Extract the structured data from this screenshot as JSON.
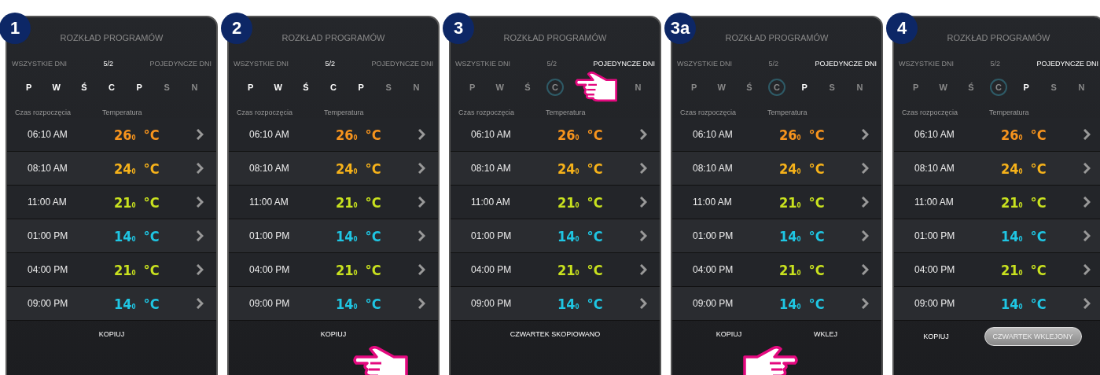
{
  "panels": [
    {
      "step": "1",
      "title": "ROZKŁAD PROGRAMÓW",
      "modes": [
        {
          "label": "WSZYSTKIE DNI",
          "selected": false
        },
        {
          "label": "5/2",
          "selected": true
        },
        {
          "label": "POJEDYNCZE DNI",
          "selected": false
        }
      ],
      "days": [
        {
          "label": "P",
          "selected": true,
          "marked": false
        },
        {
          "label": "W",
          "selected": true,
          "marked": false
        },
        {
          "label": "Ś",
          "selected": true,
          "marked": false
        },
        {
          "label": "C",
          "selected": true,
          "marked": false
        },
        {
          "label": "P",
          "selected": true,
          "marked": false
        },
        {
          "label": "S",
          "selected": false,
          "marked": false
        },
        {
          "label": "N",
          "selected": false,
          "marked": false
        }
      ],
      "headers": [
        "Czas rozpoczęcia",
        "Temperatura"
      ],
      "rows": [
        {
          "time": "06:10 AM",
          "value": "26",
          "decimal": "0",
          "unit": "°C",
          "color": "#f7941d"
        },
        {
          "time": "08:10 AM",
          "value": "24",
          "decimal": "0",
          "unit": "°C",
          "color": "#f6b21a"
        },
        {
          "time": "11:00 AM",
          "value": "21",
          "decimal": "0",
          "unit": "°C",
          "color": "#c9e21f"
        },
        {
          "time": "01:00 PM",
          "value": "14",
          "decimal": "0",
          "unit": "°C",
          "color": "#1fc6e3"
        },
        {
          "time": "04:00 PM",
          "value": "21",
          "decimal": "0",
          "unit": "°C",
          "color": "#c9e21f"
        },
        {
          "time": "09:00 PM",
          "value": "14",
          "decimal": "0",
          "unit": "°C",
          "color": "#1fc6e3"
        }
      ],
      "actions": [
        {
          "kind": "button",
          "label": "KOPIUJ"
        }
      ]
    },
    {
      "step": "2",
      "title": "ROZKŁAD PROGRAMÓW",
      "modes": [
        {
          "label": "WSZYSTKIE DNI",
          "selected": false
        },
        {
          "label": "5/2",
          "selected": true
        },
        {
          "label": "POJEDYNCZE DNI",
          "selected": false
        }
      ],
      "days": [
        {
          "label": "P",
          "selected": true,
          "marked": false
        },
        {
          "label": "W",
          "selected": true,
          "marked": false
        },
        {
          "label": "Ś",
          "selected": true,
          "marked": false
        },
        {
          "label": "C",
          "selected": true,
          "marked": false
        },
        {
          "label": "P",
          "selected": true,
          "marked": false
        },
        {
          "label": "S",
          "selected": false,
          "marked": false
        },
        {
          "label": "N",
          "selected": false,
          "marked": false
        }
      ],
      "headers": [
        "Czas rozpoczęcia",
        "Temperatura"
      ],
      "rows": [
        {
          "time": "06:10 AM",
          "value": "26",
          "decimal": "0",
          "unit": "°C",
          "color": "#f7941d"
        },
        {
          "time": "08:10 AM",
          "value": "24",
          "decimal": "0",
          "unit": "°C",
          "color": "#f6b21a"
        },
        {
          "time": "11:00 AM",
          "value": "21",
          "decimal": "0",
          "unit": "°C",
          "color": "#c9e21f"
        },
        {
          "time": "01:00 PM",
          "value": "14",
          "decimal": "0",
          "unit": "°C",
          "color": "#1fc6e3"
        },
        {
          "time": "04:00 PM",
          "value": "21",
          "decimal": "0",
          "unit": "°C",
          "color": "#c9e21f"
        },
        {
          "time": "09:00 PM",
          "value": "14",
          "decimal": "0",
          "unit": "°C",
          "color": "#1fc6e3"
        }
      ],
      "actions": [
        {
          "kind": "button",
          "label": "KOPIUJ"
        }
      ],
      "hand": {
        "kind": "bottom-left"
      }
    },
    {
      "step": "3",
      "title": "ROZKŁAD PROGRAMÓW",
      "modes": [
        {
          "label": "WSZYSTKIE DNI",
          "selected": false
        },
        {
          "label": "5/2",
          "selected": false
        },
        {
          "label": "POJEDYNCZE DNI",
          "selected": true
        }
      ],
      "days": [
        {
          "label": "P",
          "selected": false,
          "marked": false
        },
        {
          "label": "W",
          "selected": false,
          "marked": false
        },
        {
          "label": "Ś",
          "selected": false,
          "marked": false
        },
        {
          "label": "C",
          "selected": false,
          "marked": true
        },
        {
          "label": "N",
          "selected": false,
          "marked": false
        }
      ],
      "headers": [
        "Czas rozpoczęcia",
        "Temperatura"
      ],
      "rows": [
        {
          "time": "06:10 AM",
          "value": "26",
          "decimal": "0",
          "unit": "°C",
          "color": "#f7941d"
        },
        {
          "time": "08:10 AM",
          "value": "24",
          "decimal": "0",
          "unit": "°C",
          "color": "#f6b21a"
        },
        {
          "time": "11:00 AM",
          "value": "21",
          "decimal": "0",
          "unit": "°C",
          "color": "#c9e21f"
        },
        {
          "time": "01:00 PM",
          "value": "14",
          "decimal": "0",
          "unit": "°C",
          "color": "#1fc6e3"
        },
        {
          "time": "04:00 PM",
          "value": "21",
          "decimal": "0",
          "unit": "°C",
          "color": "#c9e21f"
        },
        {
          "time": "09:00 PM",
          "value": "14",
          "decimal": "0",
          "unit": "°C",
          "color": "#1fc6e3"
        }
      ],
      "actions": [
        {
          "kind": "message",
          "label": "CZWARTEK SKOPIOWANO"
        }
      ],
      "hand": {
        "kind": "days-left"
      }
    },
    {
      "step": "3a",
      "title": "ROZKŁAD PROGRAMÓW",
      "modes": [
        {
          "label": "WSZYSTKIE DNI",
          "selected": false
        },
        {
          "label": "5/2",
          "selected": false
        },
        {
          "label": "POJEDYNCZE DNI",
          "selected": true
        }
      ],
      "days": [
        {
          "label": "P",
          "selected": false,
          "marked": false
        },
        {
          "label": "W",
          "selected": false,
          "marked": false
        },
        {
          "label": "Ś",
          "selected": false,
          "marked": false
        },
        {
          "label": "C",
          "selected": false,
          "marked": true
        },
        {
          "label": "P",
          "selected": true,
          "marked": false
        },
        {
          "label": "S",
          "selected": false,
          "marked": false
        },
        {
          "label": "N",
          "selected": false,
          "marked": false
        }
      ],
      "headers": [
        "Czas rozpoczęcia",
        "Temperatura"
      ],
      "rows": [
        {
          "time": "06:10 AM",
          "value": "26",
          "decimal": "0",
          "unit": "°C",
          "color": "#f7941d"
        },
        {
          "time": "08:10 AM",
          "value": "24",
          "decimal": "0",
          "unit": "°C",
          "color": "#f6b21a"
        },
        {
          "time": "11:00 AM",
          "value": "21",
          "decimal": "0",
          "unit": "°C",
          "color": "#c9e21f"
        },
        {
          "time": "01:00 PM",
          "value": "14",
          "decimal": "0",
          "unit": "°C",
          "color": "#1fc6e3"
        },
        {
          "time": "04:00 PM",
          "value": "21",
          "decimal": "0",
          "unit": "°C",
          "color": "#c9e21f"
        },
        {
          "time": "09:00 PM",
          "value": "14",
          "decimal": "0",
          "unit": "°C",
          "color": "#1fc6e3"
        }
      ],
      "actions": [
        {
          "kind": "button",
          "label": "KOPIUJ"
        },
        {
          "kind": "button",
          "label": "WKLEJ"
        }
      ],
      "hand": {
        "kind": "bottom-right"
      }
    },
    {
      "step": "4",
      "title": "ROZKŁAD PROGRAMÓW",
      "modes": [
        {
          "label": "WSZYSTKIE DNI",
          "selected": false
        },
        {
          "label": "5/2",
          "selected": false
        },
        {
          "label": "POJEDYNCZE DNI",
          "selected": true
        }
      ],
      "days": [
        {
          "label": "P",
          "selected": false,
          "marked": false
        },
        {
          "label": "W",
          "selected": false,
          "marked": false
        },
        {
          "label": "Ś",
          "selected": false,
          "marked": false
        },
        {
          "label": "C",
          "selected": false,
          "marked": true
        },
        {
          "label": "P",
          "selected": true,
          "marked": false
        },
        {
          "label": "S",
          "selected": false,
          "marked": false
        },
        {
          "label": "N",
          "selected": false,
          "marked": false
        }
      ],
      "headers": [
        "Czas rozpoczęcia",
        "Temperatura"
      ],
      "rows": [
        {
          "time": "06:10 AM",
          "value": "26",
          "decimal": "0",
          "unit": "°C",
          "color": "#f7941d"
        },
        {
          "time": "08:10 AM",
          "value": "24",
          "decimal": "0",
          "unit": "°C",
          "color": "#f6b21a"
        },
        {
          "time": "11:00 AM",
          "value": "21",
          "decimal": "0",
          "unit": "°C",
          "color": "#c9e21f"
        },
        {
          "time": "01:00 PM",
          "value": "14",
          "decimal": "0",
          "unit": "°C",
          "color": "#1fc6e3"
        },
        {
          "time": "04:00 PM",
          "value": "21",
          "decimal": "0",
          "unit": "°C",
          "color": "#c9e21f"
        },
        {
          "time": "09:00 PM",
          "value": "14",
          "decimal": "0",
          "unit": "°C",
          "color": "#1fc6e3"
        }
      ],
      "actions": [
        {
          "kind": "button",
          "label": "KOPIUJ"
        },
        {
          "kind": "toast",
          "label": "CZWARTEK WKLEJONY"
        }
      ]
    }
  ]
}
